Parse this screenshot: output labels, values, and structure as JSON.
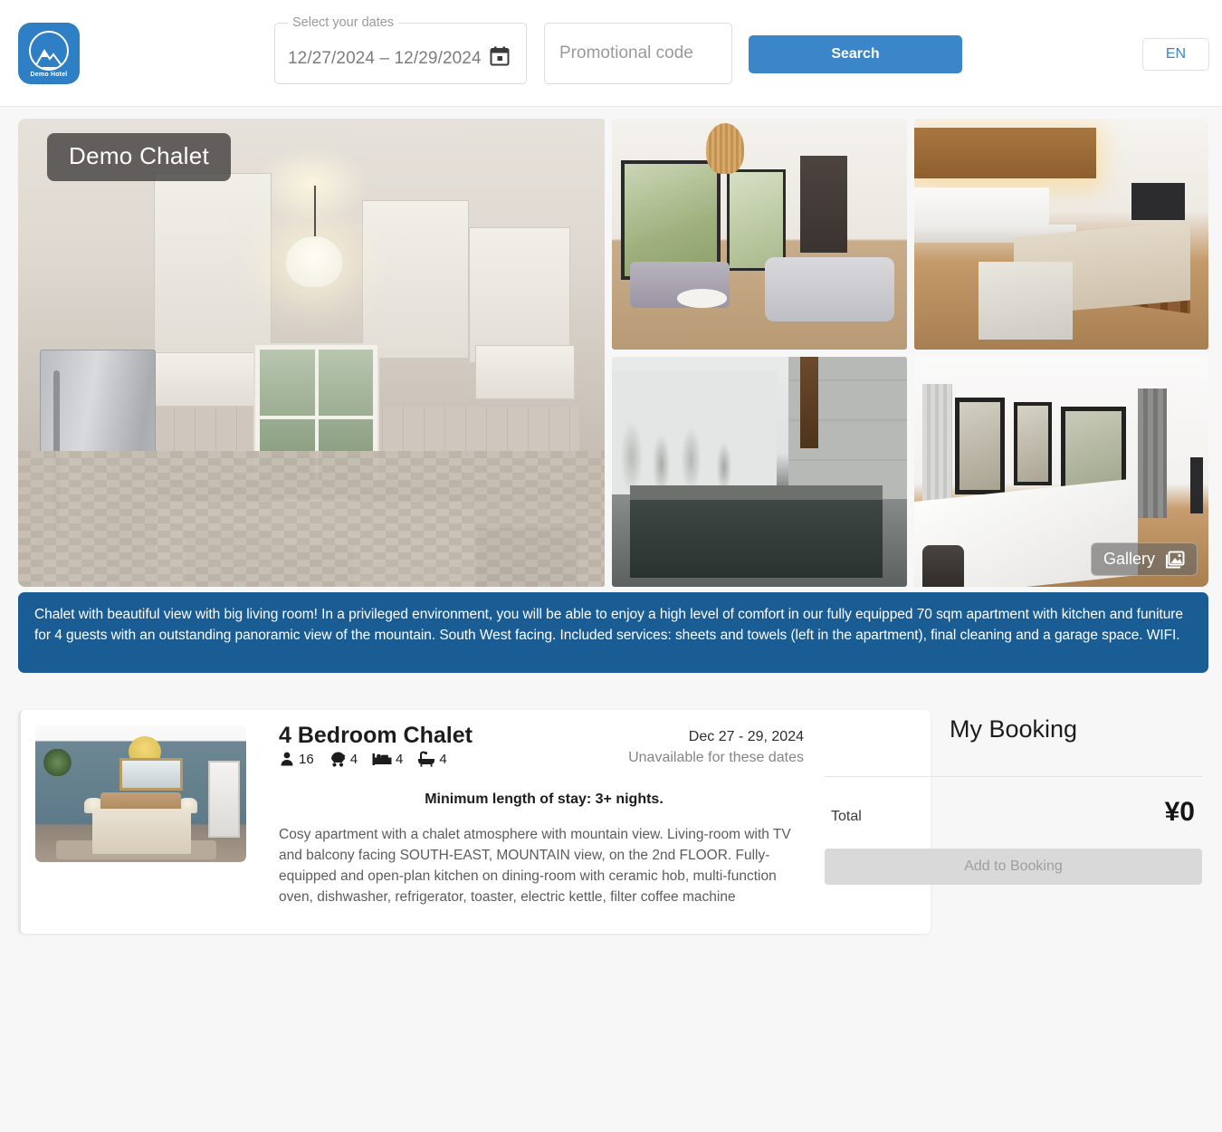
{
  "header": {
    "logo": {
      "icon": "mountain-logo-icon",
      "text": "Demo Hotel"
    },
    "date_field": {
      "label": "Select your dates",
      "value": "12/27/2024 – 12/29/2024",
      "icon": "calendar-icon"
    },
    "promo": {
      "placeholder": "Promotional code",
      "value": ""
    },
    "search_label": "Search",
    "language_label": "EN"
  },
  "gallery": {
    "title_badge": "Demo Chalet",
    "gallery_button": {
      "label": "Gallery",
      "icon": "image-icon"
    },
    "photos": [
      {
        "alt": "white-kitchen-with-island"
      },
      {
        "alt": "open-plan-living-room"
      },
      {
        "alt": "kitchen-island-with-stools"
      },
      {
        "alt": "outdoor-onsen-bath-in-snow"
      },
      {
        "alt": "living-room-with-large-windows"
      }
    ]
  },
  "description_banner": "Chalet with beautiful view with big living room! In a privileged environment, you will be able to enjoy a high level of comfort in our fully equipped 70 sqm apartment with kitchen and funiture for 4 guests with an outstanding panoramic view of the mountain. South West facing. Included services: sheets and towels (left in the apartment), final cleaning and a garage space. WIFI.",
  "room": {
    "thumbnail_alt": "bedroom-with-blue-walls",
    "title": "4 Bedroom Chalet",
    "specs": [
      {
        "icon": "person-icon",
        "value": "16"
      },
      {
        "icon": "stroller-icon",
        "value": "4"
      },
      {
        "icon": "bed-icon",
        "value": "4"
      },
      {
        "icon": "bathtub-icon",
        "value": "4"
      }
    ],
    "dates": "Dec 27 - 29, 2024",
    "availability": "Unavailable for these dates",
    "min_stay": "Minimum length of stay: 3+ nights.",
    "description": "Cosy apartment with a chalet atmosphere with mountain view. Living-room with TV and balcony facing SOUTH-EAST, MOUNTAIN view, on the 2nd FLOOR. Fully-equipped and open-plan kitchen on dining-room with ceramic hob, multi-function oven, dishwasher, refrigerator, toaster, electric kettle, filter coffee machine"
  },
  "booking": {
    "title": "My Booking",
    "total_label": "Total",
    "total_value": "¥0",
    "add_button_label": "Add to Booking"
  },
  "colors": {
    "brand_blue": "#2f7fc4",
    "search_blue": "#3b86c8",
    "banner_blue": "#1a5c94",
    "page_bg": "#f7f7f7",
    "disabled_gray": "#d9d9d9"
  }
}
